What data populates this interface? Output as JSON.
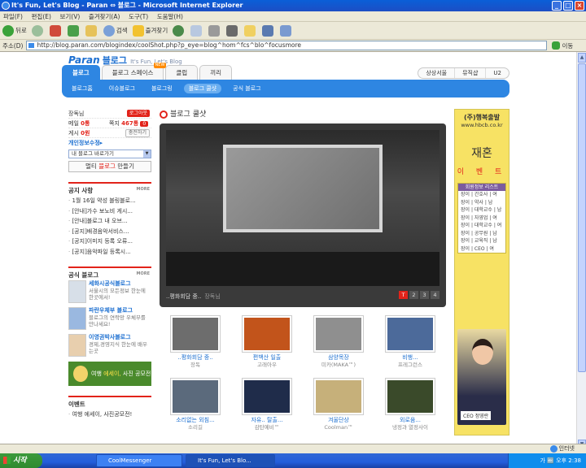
{
  "window": {
    "title": "It's Fun, Let's Blog - Paran ⇔ 블로그 - Microsoft Internet Explorer"
  },
  "menu": [
    "파일(F)",
    "편집(E)",
    "보기(V)",
    "즐겨찾기(A)",
    "도구(T)",
    "도움말(H)"
  ],
  "toolbar": {
    "back": "뒤로",
    "search": "검색",
    "favorites": "즐겨찾기"
  },
  "address": {
    "label": "주소(D)",
    "url": "http://blog.paran.com/blogindex/coolShot.php?p_eye=blog^hom^fcs^blo^focusmore",
    "go": "이동"
  },
  "site": {
    "brand": "Paran",
    "name": "블로그",
    "slogan": "It's Fun, Let's Blog"
  },
  "tabs": [
    {
      "label": "블로그"
    },
    {
      "label": "블로그 스페이스",
      "badge": "NEW"
    },
    {
      "label": "클럽"
    },
    {
      "label": "끼리"
    }
  ],
  "right_tabs": [
    "상상서울",
    "뮤직샵",
    "U2"
  ],
  "subnav": [
    "블로그홈",
    "이슈블로그",
    "블로그링",
    "블로그 쿨샷",
    "공식 블로그"
  ],
  "login": {
    "user": "장독님",
    "logout": "로그아웃",
    "mail_label": "메일",
    "mail_count": "0통",
    "note_label": "쪽지",
    "note_count": "467통",
    "note_extra": "0",
    "cafe_label": "게시",
    "cafe_count": "0원",
    "cafe_btn": "충전하기",
    "settings": "개인정보수정▸",
    "select": "내 블로그 바로가기",
    "multi_pre": "멀티 ",
    "multi_red": "블로그",
    "multi_post": " 만들기"
  },
  "notice": {
    "title": "공지 사항",
    "more": "MORE",
    "items": [
      "1월 16일 약성 블링블로...",
      "[안내]가수 보노비 게시...",
      "[안내]블로그 내 오브...",
      "[공지]배경음악서비스...",
      "[공지]이미지 등록 오류...",
      "[공지]음악파일 등록시..."
    ]
  },
  "official": {
    "title": "공식 블로그",
    "more": "MORE",
    "items": [
      {
        "name": "세화시공식블로그",
        "desc": "서울시의 모든정보 한눈에 한곳에서!"
      },
      {
        "name": "파란우체부 블로그",
        "desc": "블로그의 연락망 우체부를 만나세요!"
      },
      {
        "name": "이영권박사블로그",
        "desc": "경제,경영지식 한눈에 배우는곳"
      }
    ]
  },
  "banner": {
    "pre": "여행 ",
    "red": "에세이,",
    "post": " 사진 공모전"
  },
  "event": {
    "title": "이벤트",
    "items": [
      "여행 에세이, 사진공모전!"
    ]
  },
  "main": {
    "title": "블로그 쿨샷",
    "caption": "..평화회담 중..",
    "author": "장독님",
    "pages": [
      "T",
      "2",
      "3",
      "4"
    ]
  },
  "thumbs": [
    {
      "title": "..평화회담 중..",
      "author": "장독",
      "color": "#6d6d6d"
    },
    {
      "title": "편백산 일출",
      "author": "고래아우",
      "color": "#c2541b"
    },
    {
      "title": "삼양목장",
      "author": "미카(MAKA™)",
      "color": "#8f8f8f"
    },
    {
      "title": "비행...",
      "author": "프레그런스",
      "color": "#4c6a9a"
    },
    {
      "title": "소리없는 외침...",
      "author": "소리길",
      "color": "#5b6a7c"
    },
    {
      "title": "자유.. 탈출...",
      "author": "감탄예비™",
      "color": "#1f2c4a"
    },
    {
      "title": "겨울단상",
      "author": "Coolman™",
      "color": "#c6b07a"
    },
    {
      "title": "외로움...",
      "author": "냉정과 열정사이",
      "color": "#3a4a2a"
    }
  ],
  "ad": {
    "company": "(주)행복출발",
    "url": "www.hbcb.co.kr",
    "headline": "재혼",
    "sub": "이 벤 트",
    "list_title": "회원정보 리스트",
    "rows": [
      "장이 | 간호사 | 여",
      "장이 | 약사 | 남",
      "장이 | 대학교수 | 남",
      "장이 | 자영업 | 여",
      "장이 | 대학교수 | 여",
      "장이 | 공무원 | 남",
      "장이 | 교육직 | 남",
      "장이 | CEO | 여"
    ],
    "ceo_label": "CEO 정영란"
  },
  "status": {
    "zone": "인터넷"
  },
  "taskbar": {
    "start": "시작",
    "tasks": [
      "CoolMessenger",
      "It's Fun, Let's Blo..."
    ],
    "clock": "오후 2:38",
    "ime": "가 🔤"
  }
}
